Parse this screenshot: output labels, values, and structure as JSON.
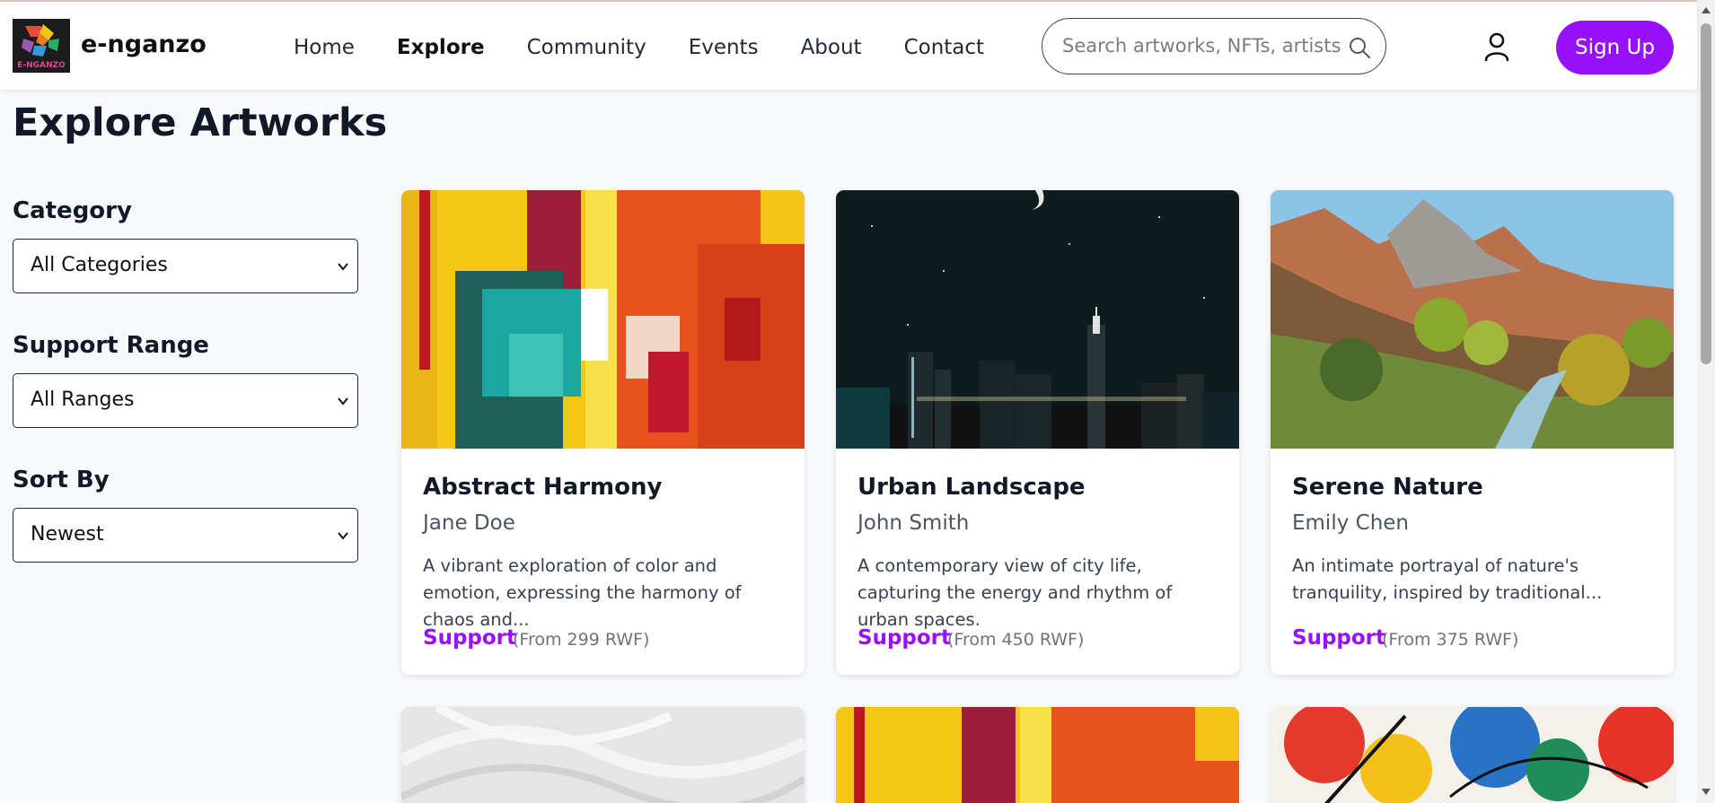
{
  "brand": {
    "name": "e-nganzo",
    "logo_text": "E-NGANZO"
  },
  "nav": {
    "items": [
      {
        "label": "Home",
        "active": false
      },
      {
        "label": "Explore",
        "active": true
      },
      {
        "label": "Community",
        "active": false
      },
      {
        "label": "Events",
        "active": false
      },
      {
        "label": "About",
        "active": false
      },
      {
        "label": "Contact",
        "active": false
      }
    ]
  },
  "search": {
    "placeholder": "Search artworks, NFTs, artists..."
  },
  "header": {
    "user_icon": "user-icon",
    "signup_label": "Sign Up"
  },
  "colors": {
    "accent": "#9810fa",
    "text": "#111827",
    "muted": "#4b5563",
    "background": "#f8f9fb"
  },
  "page": {
    "title": "Explore Artworks"
  },
  "filters": {
    "category": {
      "label": "Category",
      "value": "All Categories"
    },
    "support_range": {
      "label": "Support Range",
      "value": "All Ranges"
    },
    "sort_by": {
      "label": "Sort By",
      "value": "Newest"
    }
  },
  "artworks": [
    {
      "title": "Abstract Harmony",
      "artist": "Jane Doe",
      "description": "A vibrant exploration of color and emotion, expressing the harmony of chaos and...",
      "support_label": "Support",
      "price": "(From 299 RWF)"
    },
    {
      "title": "Urban Landscape",
      "artist": "John Smith",
      "description": "A contemporary view of city life, capturing the energy and rhythm of urban spaces.",
      "support_label": "Support",
      "price": "(From 450 RWF)"
    },
    {
      "title": "Serene Nature",
      "artist": "Emily Chen",
      "description": "An intimate portrayal of nature's tranquility, inspired by traditional...",
      "support_label": "Support",
      "price": "(From 375 RWF)"
    }
  ]
}
